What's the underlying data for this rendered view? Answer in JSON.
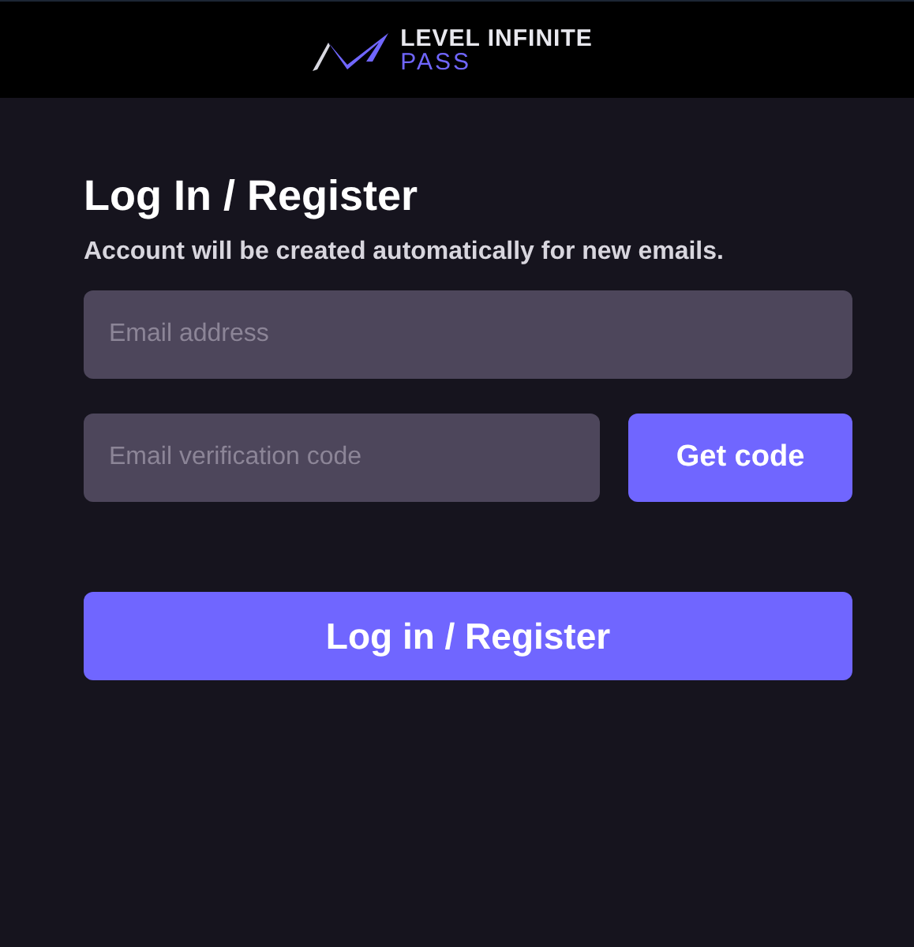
{
  "header": {
    "logo_line_1": "LEVEL INFINITE",
    "logo_line_2": "PASS"
  },
  "title": "Log In / Register",
  "subtitle": "Account will be created automatically for new emails.",
  "email_field": {
    "placeholder": "Email address"
  },
  "code_field": {
    "placeholder": "Email verification code"
  },
  "get_code_button": "Get code",
  "submit_button": "Log in / Register"
}
